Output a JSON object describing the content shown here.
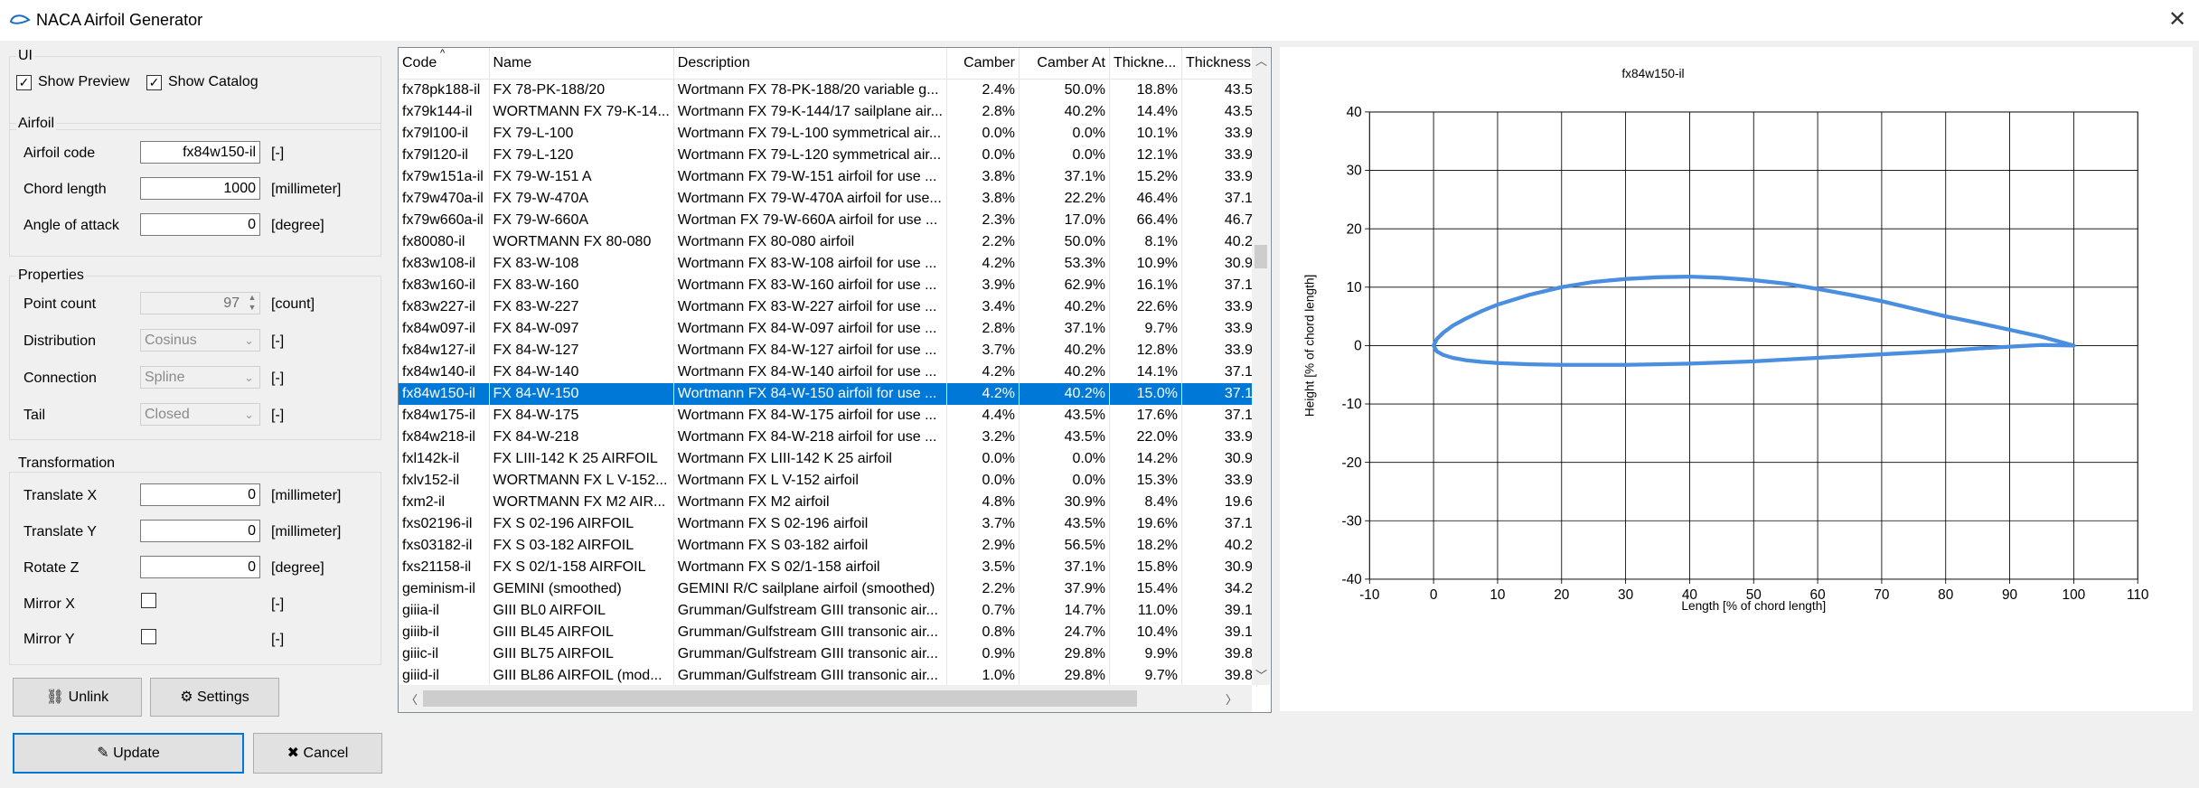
{
  "window": {
    "title": "NACA Airfoil Generator"
  },
  "ui": {
    "group_label": "UI",
    "show_preview_label": "Show Preview",
    "show_preview_checked": true,
    "show_catalog_label": "Show Catalog",
    "show_catalog_checked": true
  },
  "airfoil": {
    "group_label": "Airfoil",
    "code_label": "Airfoil code",
    "code_value": "fx84w150-il",
    "code_unit": "[-]",
    "chord_label": "Chord length",
    "chord_value": "1000",
    "chord_unit": "[millimeter]",
    "aoa_label": "Angle of attack",
    "aoa_value": "0",
    "aoa_unit": "[degree]"
  },
  "properties": {
    "group_label": "Properties",
    "point_count_label": "Point count",
    "point_count_value": "97",
    "point_count_unit": "[count]",
    "distribution_label": "Distribution",
    "distribution_value": "Cosinus",
    "distribution_unit": "[-]",
    "connection_label": "Connection",
    "connection_value": "Spline",
    "connection_unit": "[-]",
    "tail_label": "Tail",
    "tail_value": "Closed",
    "tail_unit": "[-]"
  },
  "transformation": {
    "group_label": "Transformation",
    "tx_label": "Translate X",
    "tx_value": "0",
    "tx_unit": "[millimeter]",
    "ty_label": "Translate Y",
    "ty_value": "0",
    "ty_unit": "[millimeter]",
    "rz_label": "Rotate Z",
    "rz_value": "0",
    "rz_unit": "[degree]",
    "mx_label": "Mirror X",
    "mx_checked": false,
    "mx_unit": "[-]",
    "my_label": "Mirror Y",
    "my_checked": false,
    "my_unit": "[-]"
  },
  "buttons": {
    "unlink": "Unlink",
    "settings": "Settings",
    "update": "Update",
    "cancel": "Cancel"
  },
  "catalog": {
    "columns": [
      "Code",
      "Name",
      "Description",
      "Camber",
      "Camber At",
      "Thickne...",
      "Thickness"
    ],
    "selected_index": 14,
    "rows": [
      [
        "fx78pk188-il",
        "FX 78-PK-188/20",
        "Wortmann FX 78-PK-188/20 variable g...",
        "2.4%",
        "50.0%",
        "18.8%",
        "43.5"
      ],
      [
        "fx79k144-il",
        "WORTMANN FX 79-K-14...",
        "Wortmann FX 79-K-144/17 sailplane air...",
        "2.8%",
        "40.2%",
        "14.4%",
        "43.5"
      ],
      [
        "fx79l100-il",
        "FX 79-L-100",
        "Wortmann FX 79-L-100 symmetrical air...",
        "0.0%",
        "0.0%",
        "10.1%",
        "33.9"
      ],
      [
        "fx79l120-il",
        "FX 79-L-120",
        "Wortmann FX 79-L-120 symmetrical air...",
        "0.0%",
        "0.0%",
        "12.1%",
        "33.9"
      ],
      [
        "fx79w151a-il",
        "FX 79-W-151 A",
        "Wortmann FX 79-W-151 airfoil for use ...",
        "3.8%",
        "37.1%",
        "15.2%",
        "33.9"
      ],
      [
        "fx79w470a-il",
        "FX 79-W-470A",
        "Wortmann FX 79-W-470A airfoil for use...",
        "3.8%",
        "22.2%",
        "46.4%",
        "37.1"
      ],
      [
        "fx79w660a-il",
        "FX 79-W-660A",
        "Wortman FX 79-W-660A airfoil for use ...",
        "2.3%",
        "17.0%",
        "66.4%",
        "46.7"
      ],
      [
        "fx80080-il",
        "WORTMANN FX 80-080",
        "Wortmann FX 80-080 airfoil",
        "2.2%",
        "50.0%",
        "8.1%",
        "40.2"
      ],
      [
        "fx83w108-il",
        "FX 83-W-108",
        "Wortmann FX 83-W-108 airfoil for use ...",
        "4.2%",
        "53.3%",
        "10.9%",
        "30.9"
      ],
      [
        "fx83w160-il",
        "FX 83-W-160",
        "Wortmann FX 83-W-160 airfoil for use ...",
        "3.9%",
        "62.9%",
        "16.1%",
        "37.1"
      ],
      [
        "fx83w227-il",
        "FX 83-W-227",
        "Wortmann FX 83-W-227 airfoil for use ...",
        "3.4%",
        "40.2%",
        "22.6%",
        "33.9"
      ],
      [
        "fx84w097-il",
        "FX 84-W-097",
        "Wortmann FX 84-W-097 airfoil for use ...",
        "2.8%",
        "37.1%",
        "9.7%",
        "33.9"
      ],
      [
        "fx84w127-il",
        "FX 84-W-127",
        "Wortmann FX 84-W-127 airfoil for use ...",
        "3.7%",
        "40.2%",
        "12.8%",
        "33.9"
      ],
      [
        "fx84w140-il",
        "FX 84-W-140",
        "Wortmann FX 84-W-140 airfoil for use ...",
        "4.2%",
        "40.2%",
        "14.1%",
        "37.1"
      ],
      [
        "fx84w150-il",
        "FX 84-W-150",
        "Wortmann FX 84-W-150 airfoil for use ...",
        "4.2%",
        "40.2%",
        "15.0%",
        "37.1"
      ],
      [
        "fx84w175-il",
        "FX 84-W-175",
        "Wortmann FX 84-W-175 airfoil for use ...",
        "4.4%",
        "43.5%",
        "17.6%",
        "37.1"
      ],
      [
        "fx84w218-il",
        "FX 84-W-218",
        "Wortmann FX 84-W-218 airfoil for use ...",
        "3.2%",
        "43.5%",
        "22.0%",
        "33.9"
      ],
      [
        "fxl142k-il",
        "FX LIII-142 K 25 AIRFOIL",
        "Wortmann FX LIII-142 K 25 airfoil",
        "0.0%",
        "0.0%",
        "14.2%",
        "30.9"
      ],
      [
        "fxlv152-il",
        "WORTMANN FX L V-152...",
        "Wortmann FX L V-152 airfoil",
        "0.0%",
        "0.0%",
        "15.3%",
        "33.9"
      ],
      [
        "fxm2-il",
        "WORTMANN FX M2 AIR...",
        "Wortmann FX M2 airfoil",
        "4.8%",
        "30.9%",
        "8.4%",
        "19.6"
      ],
      [
        "fxs02196-il",
        "FX S 02-196 AIRFOIL",
        "Wortmann FX S 02-196 airfoil",
        "3.7%",
        "43.5%",
        "19.6%",
        "37.1"
      ],
      [
        "fxs03182-il",
        "FX S 03-182 AIRFOIL",
        "Wortmann FX S 03-182 airfoil",
        "2.9%",
        "56.5%",
        "18.2%",
        "40.2"
      ],
      [
        "fxs21158-il",
        "FX S 02/1-158 AIRFOIL",
        "Wortmann FX S 02/1-158 airfoil",
        "3.5%",
        "37.1%",
        "15.8%",
        "30.9"
      ],
      [
        "geminism-il",
        "GEMINI (smoothed)",
        "GEMINI R/C sailplane airfoil (smoothed)",
        "2.2%",
        "37.9%",
        "15.4%",
        "34.2"
      ],
      [
        "giiia-il",
        "GIII BL0 AIRFOIL",
        "Grumman/Gulfstream GIII transonic air...",
        "0.7%",
        "14.7%",
        "11.0%",
        "39.1"
      ],
      [
        "giiib-il",
        "GIII BL45 AIRFOIL",
        "Grumman/Gulfstream GIII transonic air...",
        "0.8%",
        "24.7%",
        "10.4%",
        "39.1"
      ],
      [
        "giiic-il",
        "GIII BL75 AIRFOIL",
        "Grumman/Gulfstream GIII transonic air...",
        "0.9%",
        "29.8%",
        "9.9%",
        "39.8"
      ],
      [
        "giiid-il",
        "GIII BL86 AIRFOIL (mod...",
        "Grumman/Gulfstream GIII transonic air...",
        "1.0%",
        "29.8%",
        "9.7%",
        "39.8"
      ]
    ]
  },
  "chart_data": {
    "type": "line",
    "title": "fx84w150-il",
    "xlabel": "Length [% of chord length]",
    "ylabel": "Height [% of chord length]",
    "xlim": [
      -10,
      110
    ],
    "ylim": [
      -40,
      40
    ],
    "xticks": [
      -10,
      0,
      10,
      20,
      30,
      40,
      50,
      60,
      70,
      80,
      90,
      100,
      110
    ],
    "yticks": [
      40,
      30,
      20,
      10,
      0,
      -10,
      -20,
      -30,
      -40
    ],
    "grid": true,
    "series_color": "#4a8ee0",
    "series": [
      {
        "x": [
          100,
          95,
          90,
          85,
          80,
          75,
          70,
          65,
          60,
          55,
          50,
          45,
          40,
          35,
          30,
          25,
          20,
          15,
          10,
          7.5,
          5,
          3,
          1.5,
          0.5,
          0,
          0.5,
          1.5,
          3,
          5,
          7.5,
          10,
          15,
          20,
          25,
          30,
          35,
          40,
          45,
          50,
          55,
          60,
          65,
          70,
          75,
          80,
          85,
          90,
          95,
          100
        ],
        "y": [
          0,
          1.5,
          2.7,
          3.9,
          5.0,
          6.3,
          7.6,
          8.7,
          9.7,
          10.6,
          11.2,
          11.6,
          11.8,
          11.7,
          11.4,
          10.9,
          10.0,
          8.7,
          7.0,
          5.9,
          4.6,
          3.4,
          2.2,
          1.1,
          0,
          -1.0,
          -1.6,
          -2.1,
          -2.5,
          -2.8,
          -3.0,
          -3.2,
          -3.3,
          -3.3,
          -3.3,
          -3.2,
          -3.1,
          -2.9,
          -2.7,
          -2.4,
          -2.1,
          -1.8,
          -1.5,
          -1.2,
          -0.9,
          -0.5,
          -0.2,
          0.1,
          0
        ]
      }
    ]
  }
}
